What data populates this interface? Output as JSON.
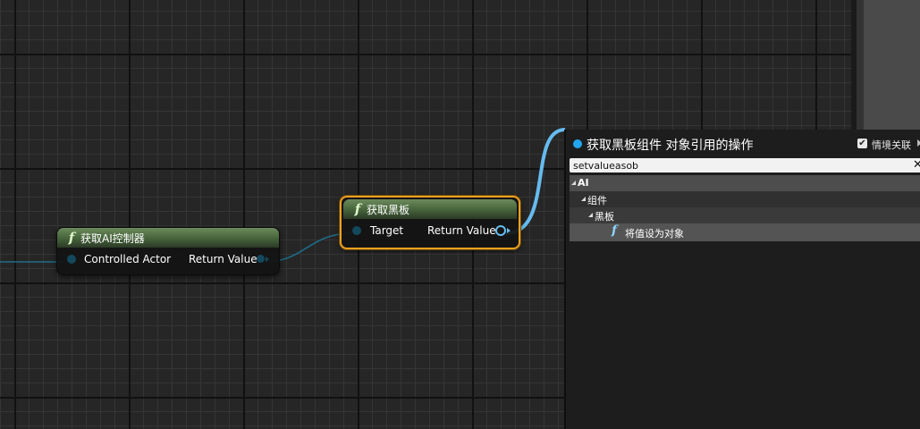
{
  "nodes": {
    "get_ai_controller": {
      "title": "获取AI控制器",
      "input_pin": "Controlled Actor",
      "output_pin": "Return Value"
    },
    "get_blackboard": {
      "title": "获取黑板",
      "input_pin": "Target",
      "output_pin": "Return Value"
    }
  },
  "action_menu": {
    "title": "获取黑板组件 对象引用的操作",
    "context_sensitive_label": "情境关联",
    "context_sensitive_checked": true,
    "search_value": "setvalueasob",
    "tree": {
      "category": "AI",
      "subcategory": "组件",
      "group": "黑板",
      "item": "将值设为对象"
    }
  },
  "colors": {
    "grid_background": "#262626",
    "function_header": "#4b6a3f",
    "selection_outline": "#f0a020",
    "object_wire": "#66bbee",
    "menu_dot": "#22a7f0"
  }
}
